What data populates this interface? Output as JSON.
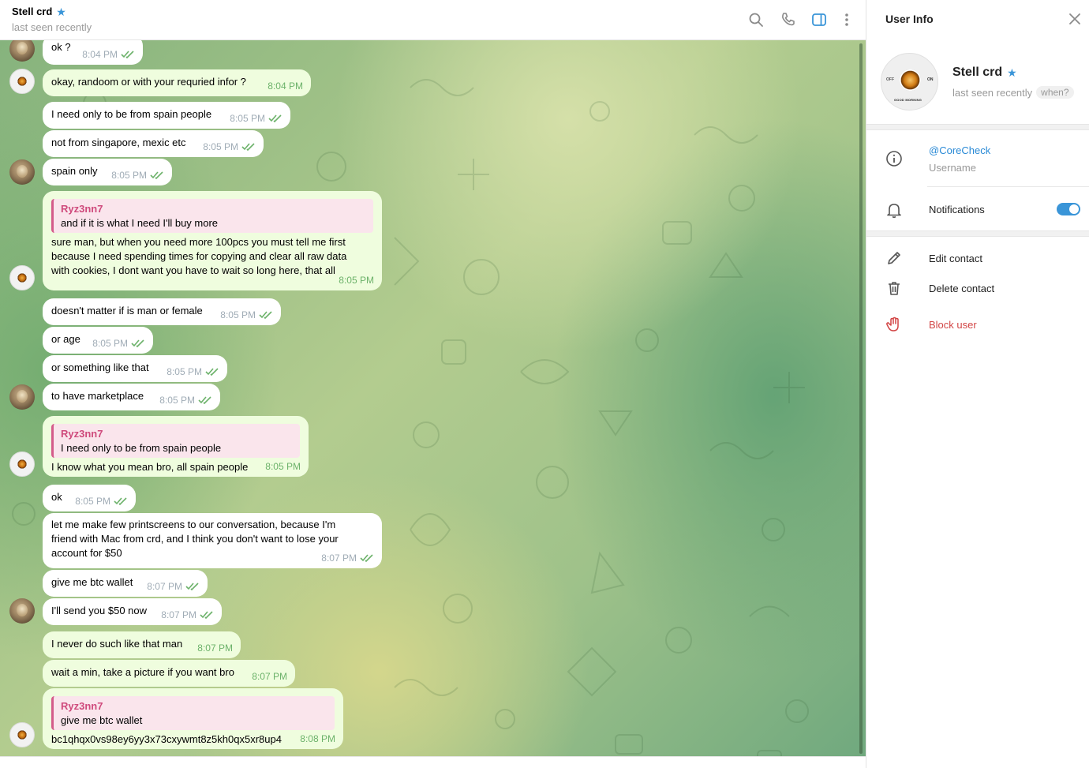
{
  "chat": {
    "title": "Stell crd",
    "status": "last seen recently",
    "messages": [
      {
        "dir": "in",
        "text": "ok ?",
        "time": "8:04 PM"
      },
      {
        "dir": "out",
        "text": "okay, randoom or with your requried infor ?",
        "time": "8:04 PM"
      },
      {
        "dir": "in",
        "text": "I need only to be from spain people",
        "time": "8:05 PM"
      },
      {
        "dir": "in",
        "text": "not from singapore, mexic etc",
        "time": "8:05 PM"
      },
      {
        "dir": "in",
        "text": "spain only",
        "time": "8:05 PM"
      },
      {
        "dir": "out",
        "quote_name": "Ryz3nn7",
        "quote_text": "and if it is what I need I'll buy more",
        "lines": [
          "sure man, but when you need more 100pcs you must tell me first",
          "because I need spending times for copying and clear all raw data",
          "with cookies, I dont want you have to wait so long here, that all"
        ],
        "time": "8:05 PM"
      },
      {
        "dir": "in",
        "text": "doesn't matter if is man or female",
        "time": "8:05 PM"
      },
      {
        "dir": "in",
        "text": "or age",
        "time": "8:05 PM"
      },
      {
        "dir": "in",
        "text": "or something like that",
        "time": "8:05 PM"
      },
      {
        "dir": "in",
        "text": "to have marketplace",
        "time": "8:05 PM"
      },
      {
        "dir": "out",
        "quote_name": "Ryz3nn7",
        "quote_text": "I need only to be from spain people",
        "text": "I know what you mean bro, all spain people",
        "time": "8:05 PM"
      },
      {
        "dir": "in",
        "text": "ok",
        "time": "8:05 PM"
      },
      {
        "dir": "in",
        "lines": [
          "let me make few printscreens to our conversation, because I'm",
          "friend with Mac from crd, and I think you don't want to lose your",
          "account for $50"
        ],
        "time": "8:07 PM"
      },
      {
        "dir": "in",
        "text": "give me btc wallet",
        "time": "8:07 PM"
      },
      {
        "dir": "in",
        "text": "I'll send you $50 now",
        "time": "8:07 PM"
      },
      {
        "dir": "out",
        "text": "I never do such like that man",
        "time": "8:07 PM"
      },
      {
        "dir": "out",
        "text": "wait a min, take a picture if you want bro",
        "time": "8:07 PM"
      },
      {
        "dir": "out",
        "quote_name": "Ryz3nn7",
        "quote_text": "give me btc wallet",
        "text": "bc1qhqx0vs98ey6yy3x73cxywmt8z5kh0qx5xr8up4",
        "time": "8:08 PM"
      }
    ]
  },
  "panel": {
    "title": "User Info",
    "name": "Stell crd",
    "status": "last seen recently",
    "when_label": "when?",
    "avatar_text": {
      "off": "OFF",
      "on": "ON",
      "caption": "GOOD MORNING"
    },
    "username": "@CoreCheck",
    "username_caption": "Username",
    "notifications_label": "Notifications",
    "notifications_on": true,
    "actions": {
      "edit": "Edit contact",
      "delete": "Delete contact",
      "block": "Block user"
    }
  },
  "colors": {
    "accent": "#3a95d8",
    "outgoing_bubble": "#effdde",
    "incoming_bubble": "#ffffff",
    "check_green": "#6cb26a",
    "quote_name": "#cf4a7c",
    "danger": "#d24545"
  },
  "icons": [
    "search-icon",
    "phone-icon",
    "sidebar-toggle-icon",
    "more-vertical-icon",
    "close-icon",
    "info-icon",
    "bell-icon",
    "pencil-icon",
    "trash-icon",
    "hand-icon",
    "star-icon",
    "double-check-icon"
  ]
}
